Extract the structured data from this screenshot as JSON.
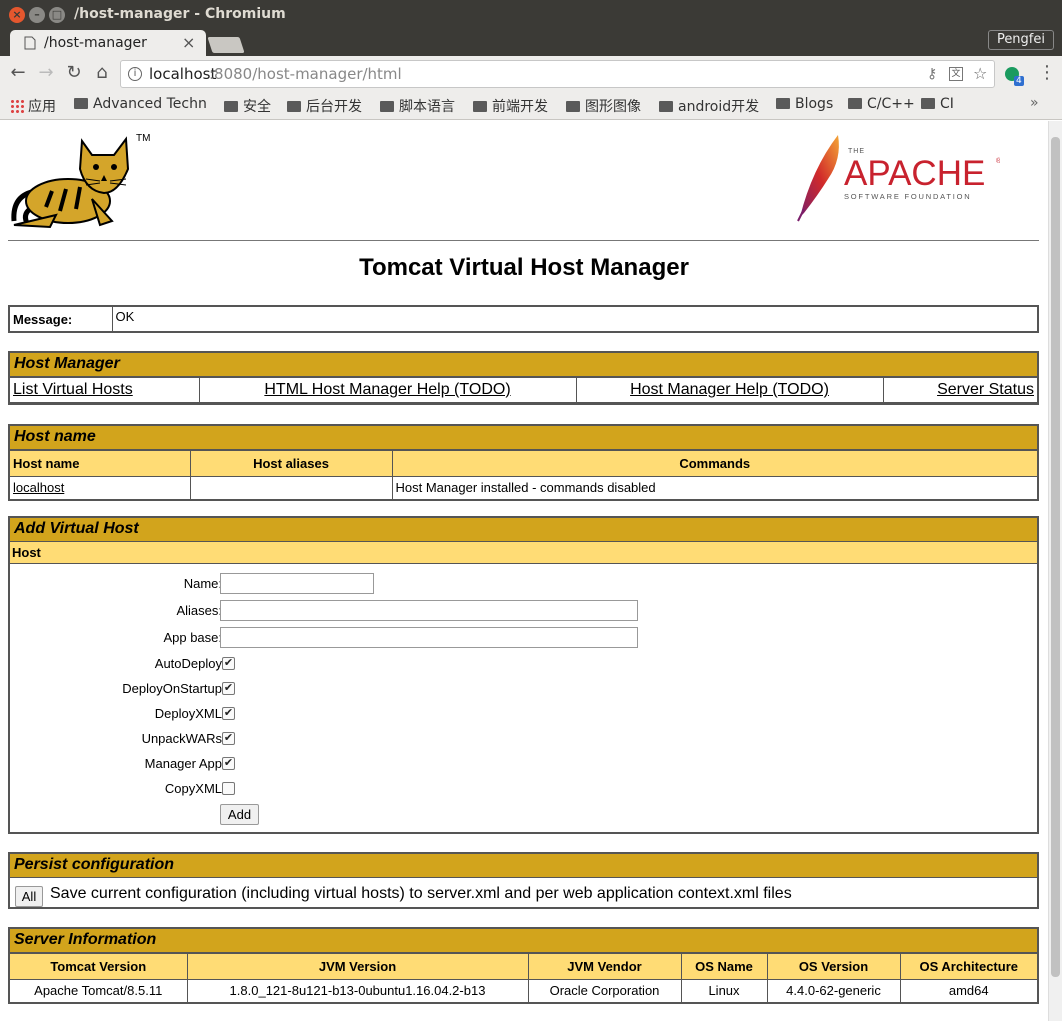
{
  "window": {
    "title": "/host-manager - Chromium"
  },
  "tab": {
    "title": "/host-manager",
    "close": "×"
  },
  "profile": "Pengfei",
  "omnibox": {
    "host": "localhost",
    "rest": ":8080/host-manager/html"
  },
  "extension_badge": "4",
  "bookmarks": [
    {
      "label": "应用"
    },
    {
      "label": "Advanced Techn"
    },
    {
      "label": "安全"
    },
    {
      "label": "后台开发"
    },
    {
      "label": "脚本语言"
    },
    {
      "label": "前端开发"
    },
    {
      "label": "图形图像"
    },
    {
      "label": "android开发"
    },
    {
      "label": "Blogs"
    },
    {
      "label": "C/C++"
    },
    {
      "label": "CI"
    }
  ],
  "logos": {
    "tomcat_tm": "TM",
    "apache_the": "THE",
    "apache_name": "APACHE",
    "apache_reg": "®",
    "apache_sub": "SOFTWARE FOUNDATION"
  },
  "page": {
    "title": "Tomcat Virtual Host Manager",
    "message_label": "Message:",
    "message_value": "OK",
    "host_manager": {
      "header": "Host Manager",
      "links": [
        "List Virtual Hosts",
        "HTML Host Manager Help (TODO)",
        "Host Manager Help (TODO)",
        "Server Status"
      ]
    },
    "host_name": {
      "header": "Host name",
      "columns": [
        "Host name",
        "Host aliases",
        "Commands"
      ],
      "rows": [
        {
          "name": "localhost",
          "aliases": "",
          "commands": "Host Manager installed - commands disabled"
        }
      ]
    },
    "add_virtual_host": {
      "header": "Add Virtual Host",
      "subheader": "Host",
      "fields": [
        {
          "label": "Name:",
          "value": ""
        },
        {
          "label": "Aliases:",
          "value": ""
        },
        {
          "label": "App base:",
          "value": ""
        }
      ],
      "checkboxes": [
        {
          "label": "AutoDeploy",
          "checked": true
        },
        {
          "label": "DeployOnStartup",
          "checked": true
        },
        {
          "label": "DeployXML",
          "checked": true
        },
        {
          "label": "UnpackWARs",
          "checked": true
        },
        {
          "label": "Manager App",
          "checked": true
        },
        {
          "label": "CopyXML",
          "checked": false
        }
      ],
      "add_button": "Add"
    },
    "persist": {
      "header": "Persist configuration",
      "button": "All",
      "text": "Save current configuration (including virtual hosts) to server.xml and per web application context.xml files"
    },
    "server_info": {
      "header": "Server Information",
      "columns": [
        "Tomcat Version",
        "JVM Version",
        "JVM Vendor",
        "OS Name",
        "OS Version",
        "OS Architecture"
      ],
      "values": [
        "Apache Tomcat/8.5.11",
        "1.8.0_121-8u121-b13-0ubuntu1.16.04.2-b13",
        "Oracle Corporation",
        "Linux",
        "4.4.0-62-generic",
        "amd64"
      ]
    }
  },
  "colors": {
    "header_bg": "#d2a41c",
    "subheader_bg": "#ffdc75",
    "apache_red": "#c8222e"
  }
}
